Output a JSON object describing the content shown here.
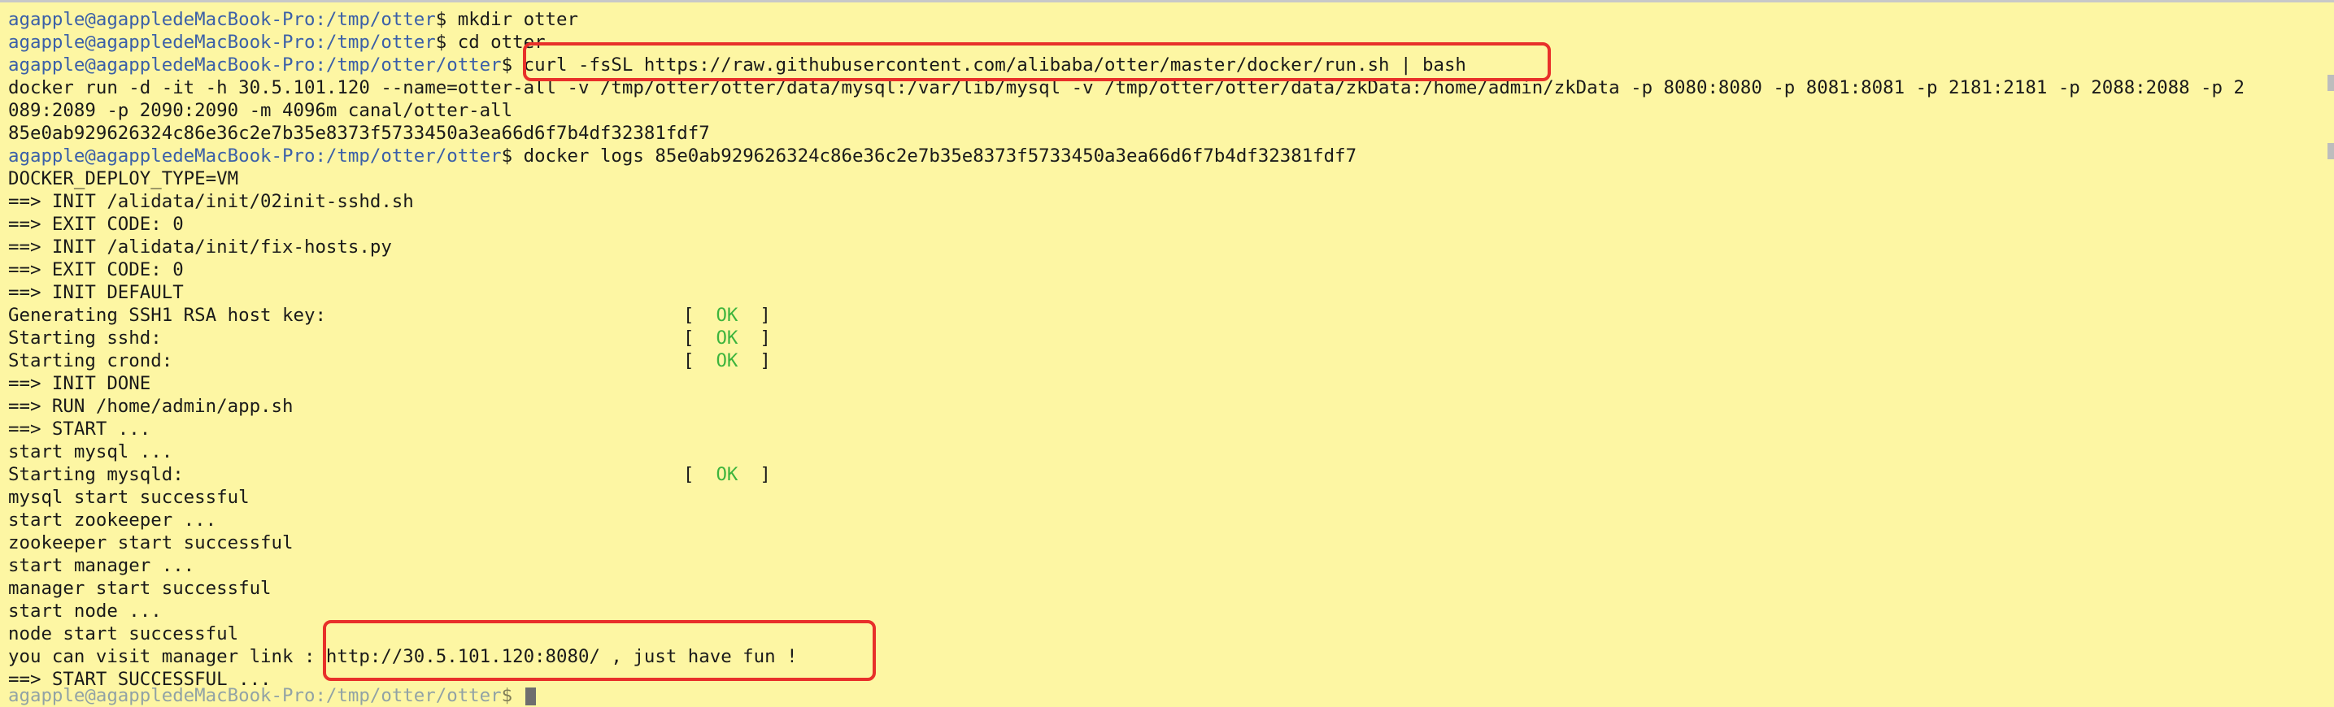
{
  "terminal": {
    "prompt_user": "agapple@agappledeMacBook-Pro",
    "lines": [
      {
        "type": "prompt",
        "path": ":/tmp/otter",
        "cmd": "mkdir otter"
      },
      {
        "type": "prompt",
        "path": ":/tmp/otter",
        "cmd": "cd otter"
      },
      {
        "type": "prompt",
        "path": ":/tmp/otter/otter",
        "cmd": "curl -fsSL https://raw.githubusercontent.com/alibaba/otter/master/docker/run.sh | bash"
      },
      {
        "type": "out",
        "text": "docker run -d -it -h 30.5.101.120 --name=otter-all -v /tmp/otter/otter/data/mysql:/var/lib/mysql -v /tmp/otter/otter/data/zkData:/home/admin/zkData -p 8080:8080 -p 8081:8081 -p 2181:2181 -p 2088:2088 -p 2"
      },
      {
        "type": "out",
        "text": "089:2089 -p 2090:2090 -m 4096m canal/otter-all"
      },
      {
        "type": "out",
        "text": "85e0ab929626324c86e36c2e7b35e8373f5733450a3ea66d6f7b4df32381fdf7"
      },
      {
        "type": "prompt",
        "path": ":/tmp/otter/otter",
        "cmd": "docker logs 85e0ab929626324c86e36c2e7b35e8373f5733450a3ea66d6f7b4df32381fdf7"
      },
      {
        "type": "out",
        "text": "DOCKER_DEPLOY_TYPE=VM"
      },
      {
        "type": "out",
        "text": "==> INIT /alidata/init/02init-sshd.sh"
      },
      {
        "type": "out",
        "text": "==> EXIT CODE: 0"
      },
      {
        "type": "out",
        "text": "==> INIT /alidata/init/fix-hosts.py"
      },
      {
        "type": "out",
        "text": "==> EXIT CODE: 0"
      },
      {
        "type": "out",
        "text": "==> INIT DEFAULT"
      },
      {
        "type": "status",
        "text": "Generating SSH1 RSA host key:",
        "status": "OK"
      },
      {
        "type": "status",
        "text": "Starting sshd:",
        "status": "OK"
      },
      {
        "type": "status",
        "text": "Starting crond:",
        "status": "OK"
      },
      {
        "type": "out",
        "text": "==> INIT DONE"
      },
      {
        "type": "out",
        "text": "==> RUN /home/admin/app.sh"
      },
      {
        "type": "out",
        "text": "==> START ..."
      },
      {
        "type": "out",
        "text": "start mysql ..."
      },
      {
        "type": "status",
        "text": "Starting mysqld:",
        "status": "OK"
      },
      {
        "type": "out",
        "text": "mysql start successful"
      },
      {
        "type": "out",
        "text": "start zookeeper ..."
      },
      {
        "type": "out",
        "text": "zookeeper start successful"
      },
      {
        "type": "out",
        "text": "start manager ..."
      },
      {
        "type": "out",
        "text": "manager start successful"
      },
      {
        "type": "out",
        "text": "start node ..."
      },
      {
        "type": "out",
        "text": "node start successful"
      },
      {
        "type": "out",
        "text": "you can visit manager link : http://30.5.101.120:8080/ , just have fun !"
      },
      {
        "type": "out",
        "text": "==> START SUCCESSFUL ..."
      },
      {
        "type": "prompt-partial",
        "path": ":/tmp/otter/otter",
        "cmd": ""
      }
    ]
  },
  "colors": {
    "background": "#fdf6a3",
    "prompt": "#3a5fa8",
    "ok": "#3db43d",
    "highlight": "#e8302a"
  }
}
